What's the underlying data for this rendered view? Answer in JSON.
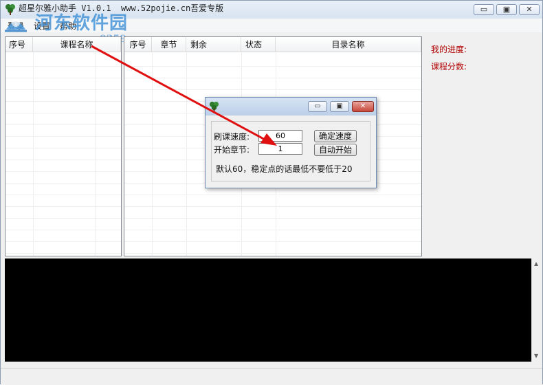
{
  "window": {
    "title": "超星尔雅小助手 V1.0.1  www.52pojie.cn吾爱专版",
    "icon": "clover-icon",
    "controls": {
      "minimize": "▭",
      "maximize": "▣",
      "close": "✕"
    }
  },
  "watermark": {
    "title": "河东软件园",
    "url": "www.pc0359.cn"
  },
  "menu": {
    "items": [
      "登录",
      "设置",
      "帮助"
    ]
  },
  "left_list": {
    "columns": [
      "序号",
      "课程名称"
    ]
  },
  "mid_list": {
    "columns": [
      "序号",
      "章节",
      "剩余",
      "状态",
      "目录名称"
    ]
  },
  "info": {
    "progress_label": "我的进度:",
    "score_label": "课程分数:",
    "label_color": "#b00000"
  },
  "dialog": {
    "speed_label": "刷课速度:",
    "speed_value": "60",
    "chapter_label": "开始章节:",
    "chapter_value": "1",
    "confirm_button": "确定速度",
    "start_button": "自动开始",
    "hint": "默认60，稳定点的话最低不要低于20"
  },
  "annotation": {
    "color": "#e01010"
  }
}
